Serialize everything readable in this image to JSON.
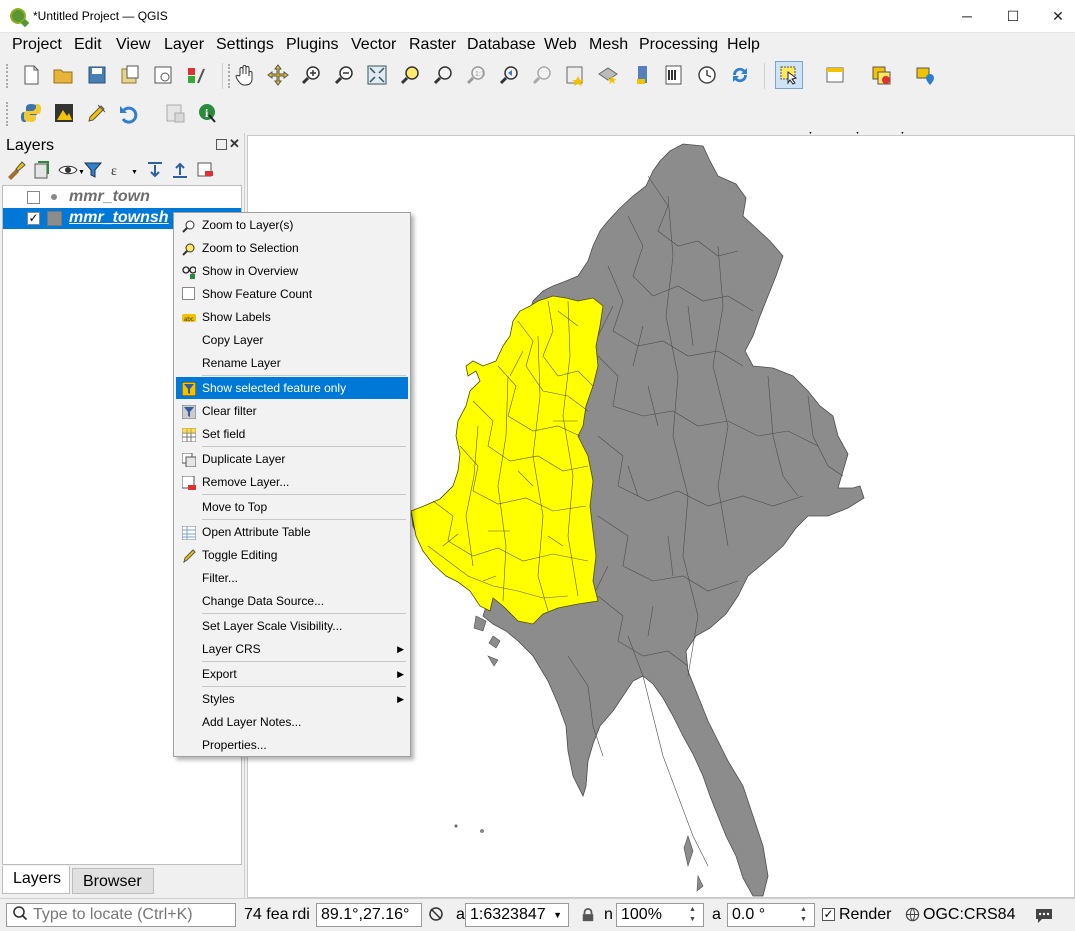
{
  "window": {
    "title": "*Untitled Project — QGIS",
    "minimize": "─",
    "maximize": "☐",
    "close": "✕"
  },
  "menubar": [
    "Project",
    "Edit",
    "View",
    "Layer",
    "Settings",
    "Plugins",
    "Vector",
    "Raster",
    "Database",
    "Web",
    "Mesh",
    "Processing",
    "Help"
  ],
  "toolbar_icons": [
    "new-project-icon",
    "open-project-icon",
    "save-project-icon",
    "save-as-icon",
    "print-layout-icon",
    "style-manager-icon",
    "pan-icon",
    "pan-to-selection-icon",
    "zoom-in-icon",
    "zoom-out-icon",
    "zoom-full-icon",
    "zoom-to-selection-icon",
    "zoom-to-layer-icon",
    "zoom-native-icon",
    "zoom-last-icon",
    "zoom-next-icon",
    "new-bookmark-icon",
    "show-bookmarks-icon",
    "new-map-view-icon",
    "new-3d-view-icon",
    "temporal-controller-icon",
    "refresh-icon",
    "select-features-icon",
    "attribute-table-icon",
    "deselect-icon",
    "identify-marker-icon"
  ],
  "toolbar2_icons": [
    "python-icon",
    "plugin-icon",
    "pen-tool-icon",
    "undo-icon",
    "disabled-tool-icon",
    "identify-features-icon"
  ],
  "layers_panel": {
    "title": "Layers",
    "layers": [
      {
        "name": "mmr_town",
        "checked": false
      },
      {
        "name": "mmr_townsh",
        "checked": true
      }
    ],
    "tabs": [
      "Layers",
      "Browser"
    ]
  },
  "context_menu": {
    "items": [
      {
        "label": "Zoom to Layer(s)",
        "icon": "zoom-layer-icon"
      },
      {
        "label": "Zoom to Selection",
        "icon": "zoom-selection-icon"
      },
      {
        "label": "Show in Overview",
        "icon": "overview-icon"
      },
      {
        "label": "Show Feature Count",
        "icon": "checkbox-icon"
      },
      {
        "label": "Show Labels",
        "icon": "labels-icon"
      },
      {
        "label": "Copy Layer",
        "icon": ""
      },
      {
        "label": "Rename Layer",
        "icon": ""
      },
      {
        "label": "Show selected feature only",
        "icon": "filter-selected-icon"
      },
      {
        "label": "Clear filter",
        "icon": "clear-filter-icon"
      },
      {
        "label": "Set field",
        "icon": "set-field-icon"
      },
      {
        "label": "Duplicate Layer",
        "icon": "duplicate-layer-icon"
      },
      {
        "label": "Remove Layer...",
        "icon": "remove-layer-icon"
      },
      {
        "label": "Move to Top",
        "icon": ""
      },
      {
        "label": "Open Attribute Table",
        "icon": "attribute-table-icon"
      },
      {
        "label": "Toggle Editing",
        "icon": "pencil-icon"
      },
      {
        "label": "Filter...",
        "icon": ""
      },
      {
        "label": "Change Data Source...",
        "icon": ""
      },
      {
        "label": "Set Layer Scale Visibility...",
        "icon": ""
      },
      {
        "label": "Layer CRS",
        "icon": "",
        "submenu": true
      },
      {
        "label": "Export",
        "icon": "",
        "submenu": true
      },
      {
        "label": "Styles",
        "icon": "",
        "submenu": true
      },
      {
        "label": "Add Layer Notes...",
        "icon": ""
      },
      {
        "label": "Properties...",
        "icon": ""
      }
    ],
    "active_item": "Show selected feature only"
  },
  "statusbar": {
    "locate_placeholder": "Type to locate (Ctrl+K)",
    "feature_text": "74 fea",
    "coord_label": "rdi",
    "coordinate": "89.1°,27.16°",
    "scale_label": "a",
    "scale": "1:6323847",
    "magnifier_label": "n",
    "magnifier": "100%",
    "rotation_label": "a",
    "rotation": "0.0 °",
    "render_label": "Render",
    "render_checked": true,
    "crs": "OGC:CRS84"
  },
  "colors": {
    "selected_fill": "#ffff00",
    "unselected_fill": "#8c8c8c",
    "highlight": "#0078d7"
  }
}
